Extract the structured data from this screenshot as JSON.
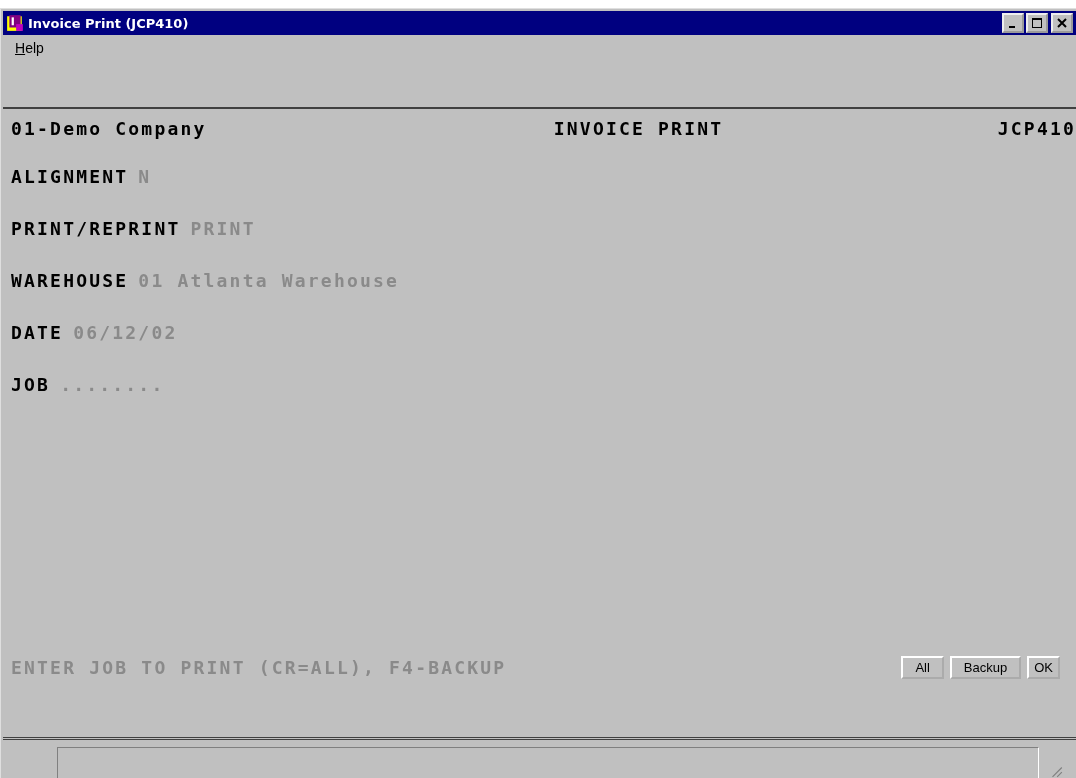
{
  "window": {
    "title": "Invoice Print (JCP410)"
  },
  "menu": [
    {
      "label": "Help"
    }
  ],
  "header": {
    "company": "01-Demo Company",
    "title": "INVOICE PRINT",
    "program": "JCP410"
  },
  "fields": [
    {
      "label": "ALIGNMENT",
      "value": "N"
    },
    {
      "label": "PRINT/REPRINT",
      "value": "PRINT"
    },
    {
      "label": "WAREHOUSE",
      "value": "01 Atlanta Warehouse"
    },
    {
      "label": "DATE",
      "value": "06/12/02"
    },
    {
      "label": "JOB",
      "value": "........"
    }
  ],
  "prompt": "ENTER JOB TO PRINT (CR=ALL), F4-BACKUP",
  "buttons": [
    {
      "label": "All"
    },
    {
      "label": "Backup"
    },
    {
      "label": "OK"
    }
  ]
}
